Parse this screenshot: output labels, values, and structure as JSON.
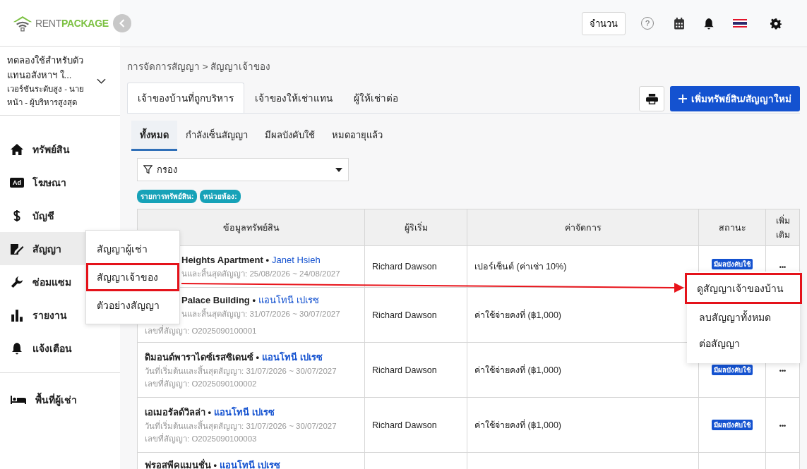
{
  "logo": {
    "first": "RENT",
    "second": "PACKAGE"
  },
  "account": {
    "name": "ทดลองใช้สำหรับตัวแทนอสังหาฯ ใ...",
    "plan": "เวอร์ชันระดับสูง - นายหน้า - ผู้บริหารสูงสุด"
  },
  "sidebar": {
    "items": [
      {
        "label": "ทรัพย์สิน",
        "selected": false
      },
      {
        "label": "โฆษณา",
        "selected": false,
        "badge": "Ad"
      },
      {
        "label": "บัญชี",
        "selected": false
      },
      {
        "label": "สัญญา",
        "selected": true
      },
      {
        "label": "ซ่อมแซม",
        "selected": false
      },
      {
        "label": "รายงาน",
        "selected": false
      },
      {
        "label": "แจ้งเตือน",
        "selected": false
      }
    ],
    "bottom_item": {
      "label": "พื้นที่ผู้เช่า"
    }
  },
  "header": {
    "count_button": "จำนวน",
    "help": "?"
  },
  "breadcrumb": "การจัดการสัญญา > สัญญาเจ้าของ",
  "tabs": [
    {
      "label": "เจ้าของบ้านที่ถูกบริหาร",
      "selected": true
    },
    {
      "label": "เจ้าของให้เช่าแทน",
      "selected": false
    },
    {
      "label": "ผู้ให้เช่าต่อ",
      "selected": false
    }
  ],
  "add_button": "เพิ่มทรัพย์สิน/สัญญาใหม่",
  "sub_tabs": [
    {
      "label": "ทั้งหมด",
      "selected": true
    },
    {
      "label": "กำลังเซ็นสัญญา",
      "selected": false
    },
    {
      "label": "มีผลบังคับใช้",
      "selected": false
    },
    {
      "label": "หมดอายุแล้ว",
      "selected": false
    }
  ],
  "filter": {
    "placeholder": "กรอง"
  },
  "chips": [
    "รายการทรัพย์สิน:",
    "หน่วยห้อง:"
  ],
  "table": {
    "columns": [
      "ข้อมูลทรัพย์สิน",
      "ผู้ริเริ่ม",
      "ค่าจัดการ",
      "สถานะ",
      "เพิ่มเติม"
    ],
    "rows": [
      {
        "kind": "covered",
        "property": "Heights Apartment •",
        "owner": "Janet Hsieh",
        "dates": "นและสิ้นสุดสัญญา: 25/08/2026 ~ 24/08/2027",
        "initiator": "Richard Dawson",
        "fee": "เปอร์เซ็นต์ (ค่าเช่า 10%)",
        "status": "มีผลบังคับใช้",
        "more": "•••"
      },
      {
        "kind": "covered",
        "property": "Palace Building •",
        "owner": "แอนโทนี เปเรซ",
        "dates": "นและสิ้นสุดสัญญา: 31/07/2026 ~ 30/07/2027",
        "contract_no": "เลขที่สัญญา: O2025090100001",
        "initiator": "Richard Dawson",
        "fee": "ค่าใช้จ่ายคงที่ (฿1,000)"
      },
      {
        "kind": "full",
        "property": "ดิมอนด์พาราไดซ์เรสซิเดนซ์ •",
        "owner": "แอนโทนี เปเรซ",
        "dates": "วันที่เริ่มต้นและสิ้นสุดสัญญา: 31/07/2026 ~ 30/07/2027",
        "contract_no": "เลขที่สัญญา: O2025090100002",
        "initiator": "Richard Dawson",
        "fee": "ค่าใช้จ่ายคงที่ (฿1,000)",
        "status": "มีผลบังคับใช้",
        "more": "•••"
      },
      {
        "kind": "full",
        "property": "เอเมอรัลด์วิลล่า •",
        "owner": "แอนโทนี เปเรซ",
        "dates": "วันที่เริ่มต้นและสิ้นสุดสัญญา: 31/07/2026 ~ 30/07/2027",
        "contract_no": "เลขที่สัญญา: O2025090100003",
        "initiator": "Richard Dawson",
        "fee": "ค่าใช้จ่ายคงที่ (฿1,000)",
        "status": "มีผลบังคับใช้",
        "more": "•••"
      },
      {
        "kind": "full",
        "property": "ฟรอสพีคแมนชั่น •",
        "owner": "แอนโทนี เปเรซ"
      }
    ]
  },
  "contract_menu": [
    {
      "label": "สัญญาผู้เช่า",
      "selected": false
    },
    {
      "label": "สัญญาเจ้าของ",
      "selected": true
    },
    {
      "label": "ตัวอย่างสัญญา",
      "selected": false
    }
  ],
  "row_menu": [
    {
      "label": "ดูสัญญาเจ้าของบ้าน",
      "selected": true
    },
    {
      "label": "ลบสัญญาทั้งหมด",
      "selected": false
    },
    {
      "label": "ต่อสัญญา",
      "selected": false
    }
  ]
}
